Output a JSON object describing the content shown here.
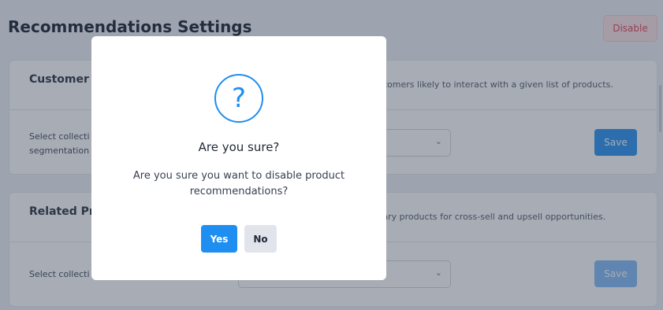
{
  "page": {
    "title": "Recommendations Settings",
    "disable_label": "Disable"
  },
  "cards": [
    {
      "title": "Customer S",
      "description": "stomers likely to interact with a given list of products.",
      "label": "Select collecti segmentation",
      "select_value": "",
      "save_label": "Save"
    },
    {
      "title": "Related Pro",
      "description": "tary products for cross-sell and upsell opportunities.",
      "label": "Select collecti",
      "select_value": "",
      "save_label": "Save"
    }
  ],
  "modal": {
    "icon": "question-circle-icon",
    "title": "Are you sure?",
    "message": "Are you sure you want to disable product recommendations?",
    "yes_label": "Yes",
    "no_label": "No"
  },
  "colors": {
    "primary": "#1f8ef1",
    "danger": "#e23c4f",
    "danger_bg": "#fde2e4"
  }
}
